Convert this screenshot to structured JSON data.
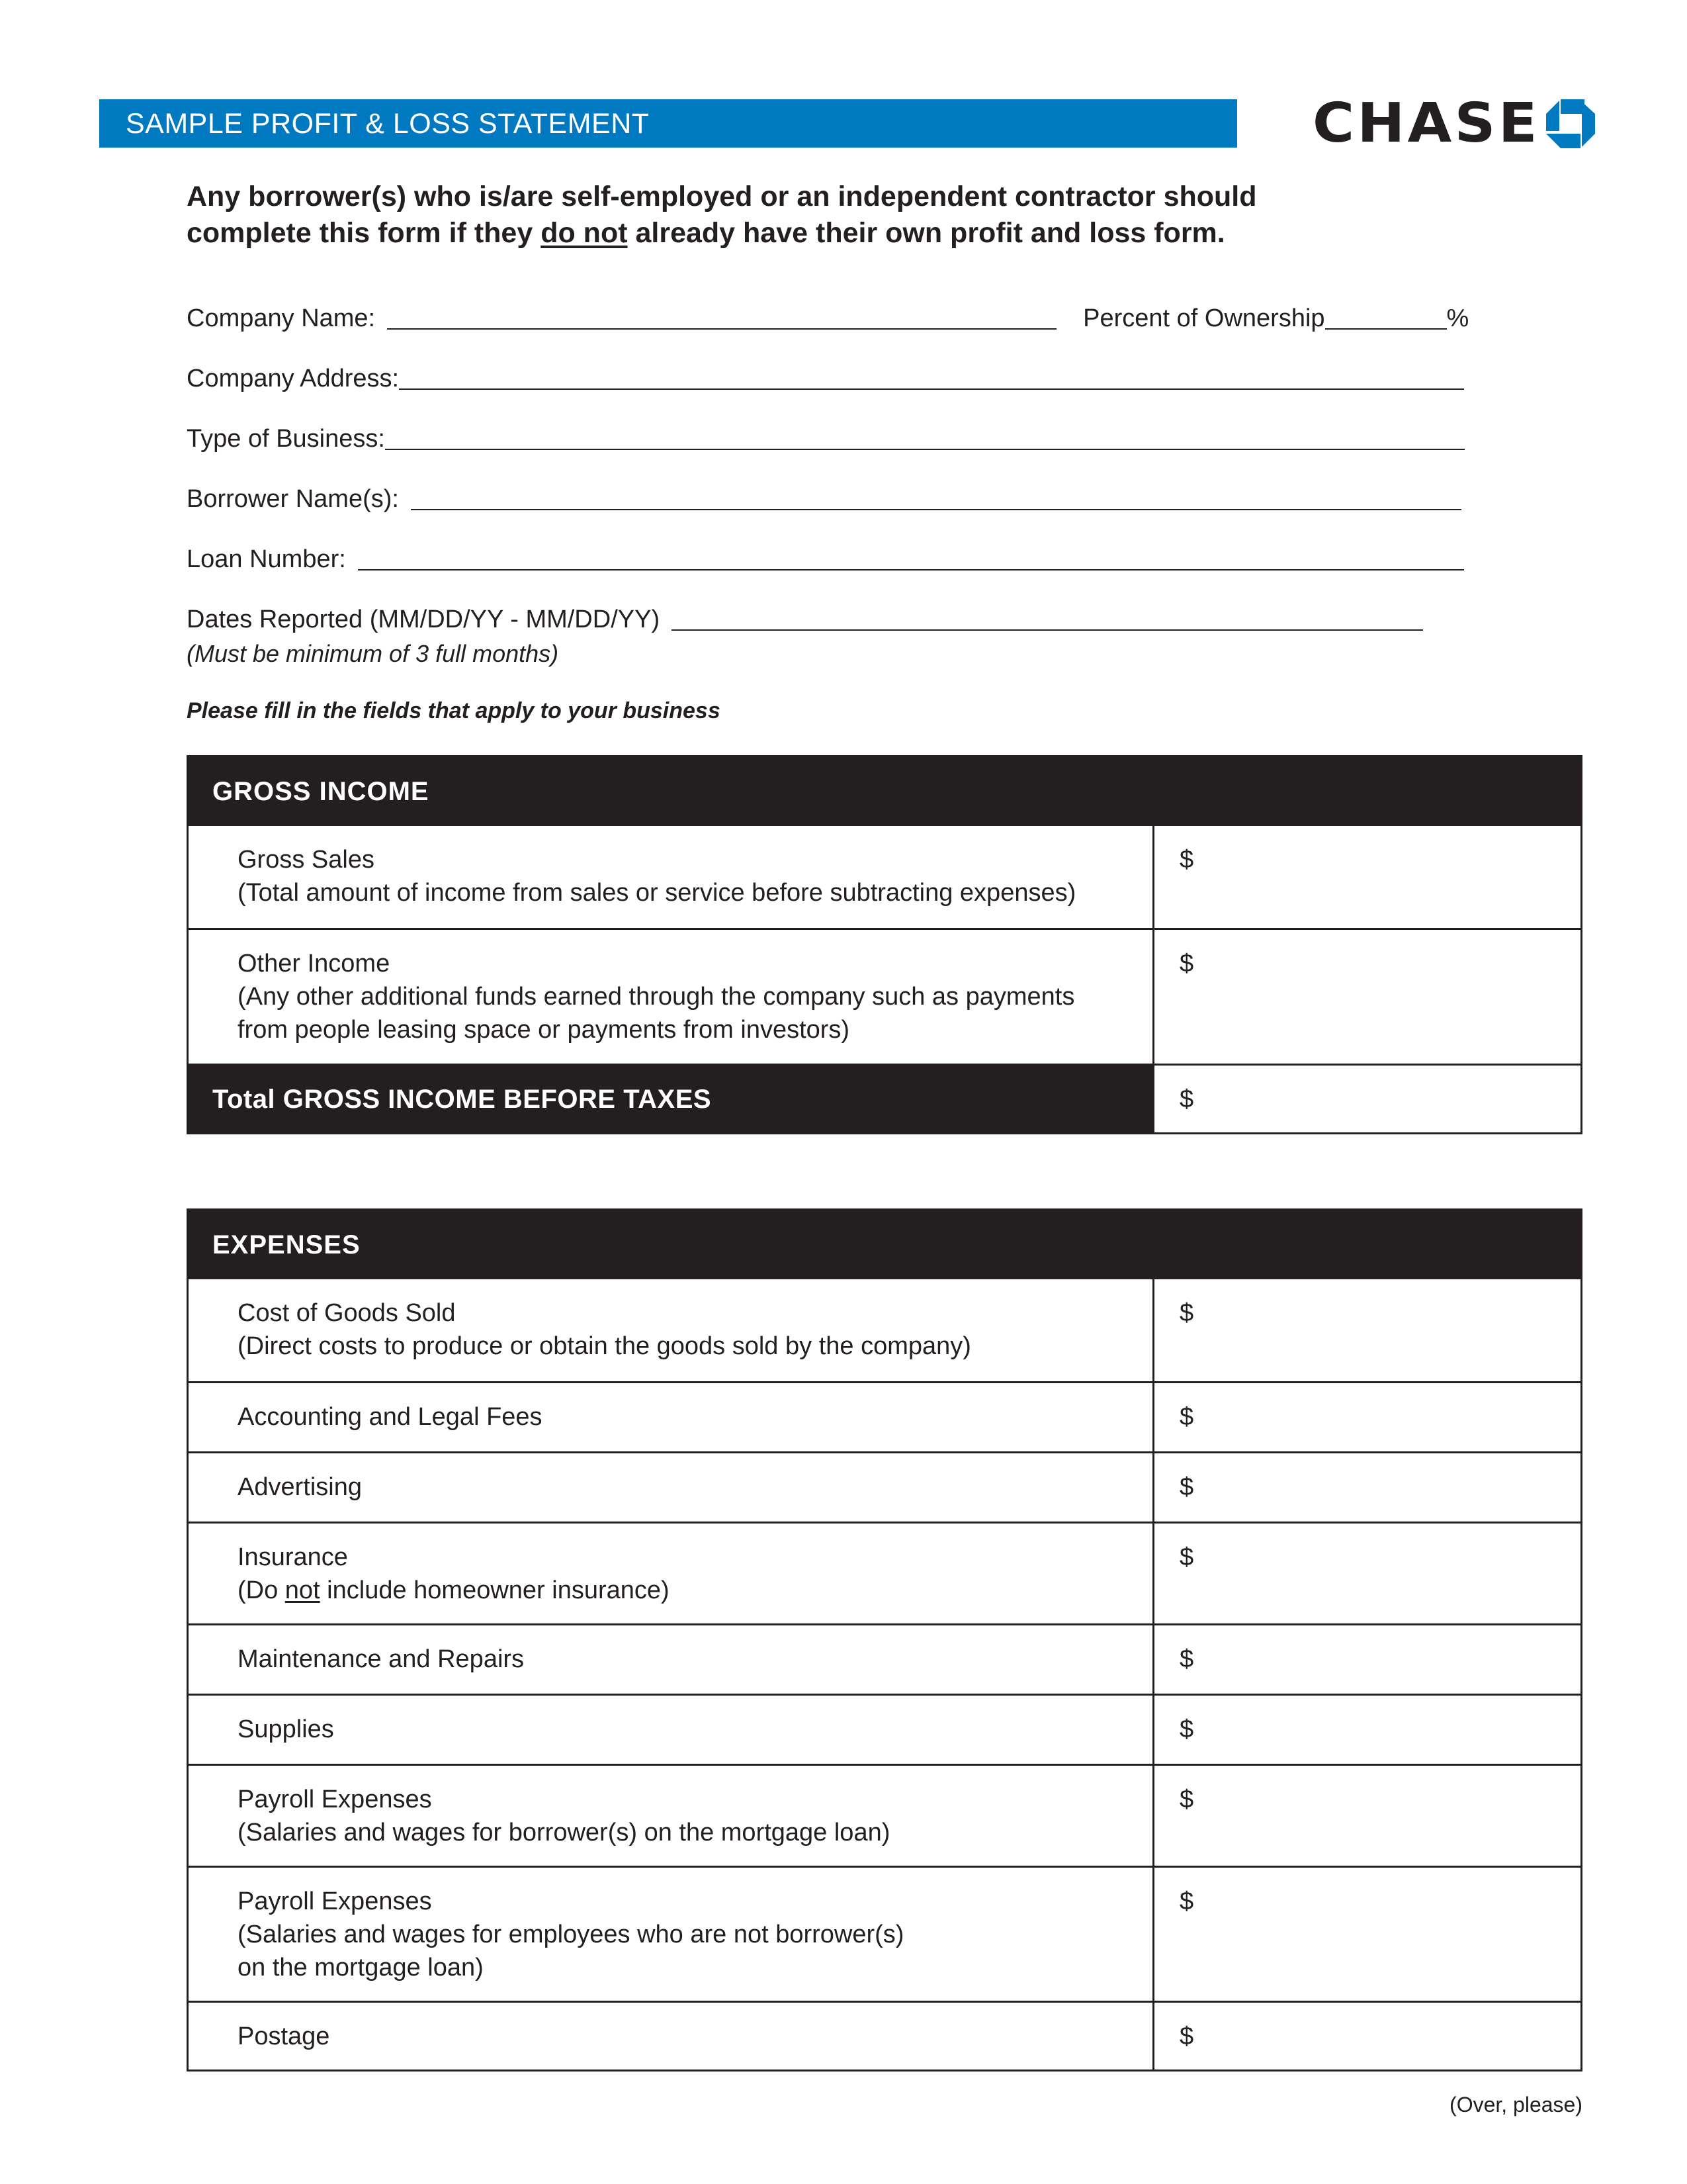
{
  "header": {
    "title": "SAMPLE PROFIT & LOSS STATEMENT",
    "logo_text": "CHASE",
    "logo_icon": "chase-octagon-icon",
    "brand_color": "#0079c1",
    "dark_color": "#231f20"
  },
  "intro": {
    "line1": "Any borrower(s) who is/are self-employed or an independent contractor should",
    "line2_before": "complete this form if they ",
    "line2_underlined": "do not",
    "line2_after": " already have their own profit and loss form."
  },
  "fields": {
    "company_name": {
      "label": "Company Name:",
      "value": ""
    },
    "percent_ownership": {
      "label": "Percent of Ownership",
      "suffix": "%",
      "value": ""
    },
    "company_address": {
      "label": "Company Address:",
      "value": ""
    },
    "type_of_business": {
      "label": "Type of Business:",
      "value": ""
    },
    "borrower_names": {
      "label": "Borrower Name(s):",
      "value": ""
    },
    "loan_number": {
      "label": "Loan Number:",
      "value": ""
    },
    "dates_reported": {
      "label": "Dates Reported (MM/DD/YY - MM/DD/YY)",
      "value": "",
      "note": "(Must be minimum of 3 full months)"
    }
  },
  "instruction": "Please fill in the fields that apply to your business",
  "gross_income": {
    "heading": "GROSS INCOME",
    "rows": [
      {
        "label": "Gross Sales",
        "detail": "(Total amount of income from sales or service before subtracting expenses)",
        "currency": "$",
        "value": ""
      },
      {
        "label": "Other Income",
        "detail": "(Any other additional funds earned through the company such as payments",
        "detail2": "from people leasing space or payments from investors)",
        "currency": "$",
        "value": ""
      }
    ],
    "total": {
      "prefix": "Total ",
      "label": "GROSS INCOME BEFORE TAXES",
      "currency": "$",
      "value": ""
    }
  },
  "expenses": {
    "heading": "EXPENSES",
    "rows": [
      {
        "label": "Cost of Goods Sold",
        "detail": "(Direct costs to produce or obtain the goods sold by the company)",
        "currency": "$",
        "value": ""
      },
      {
        "label": "Accounting and Legal Fees",
        "currency": "$",
        "value": ""
      },
      {
        "label": "Advertising",
        "currency": "$",
        "value": ""
      },
      {
        "label": "Insurance",
        "detail_before": "(Do ",
        "detail_underlined": "not",
        "detail_after": " include homeowner insurance)",
        "currency": "$",
        "value": ""
      },
      {
        "label": "Maintenance and Repairs",
        "currency": "$",
        "value": ""
      },
      {
        "label": "Supplies",
        "currency": "$",
        "value": ""
      },
      {
        "label": "Payroll Expenses",
        "detail": "(Salaries and wages for borrower(s) on the mortgage loan)",
        "currency": "$",
        "value": ""
      },
      {
        "label": "Payroll Expenses",
        "detail": "(Salaries and wages for employees who are not borrower(s)",
        "detail2": "on the mortgage loan)",
        "currency": "$",
        "value": ""
      },
      {
        "label": "Postage",
        "currency": "$",
        "value": ""
      }
    ]
  },
  "footer": {
    "text": "(Over, please)"
  }
}
